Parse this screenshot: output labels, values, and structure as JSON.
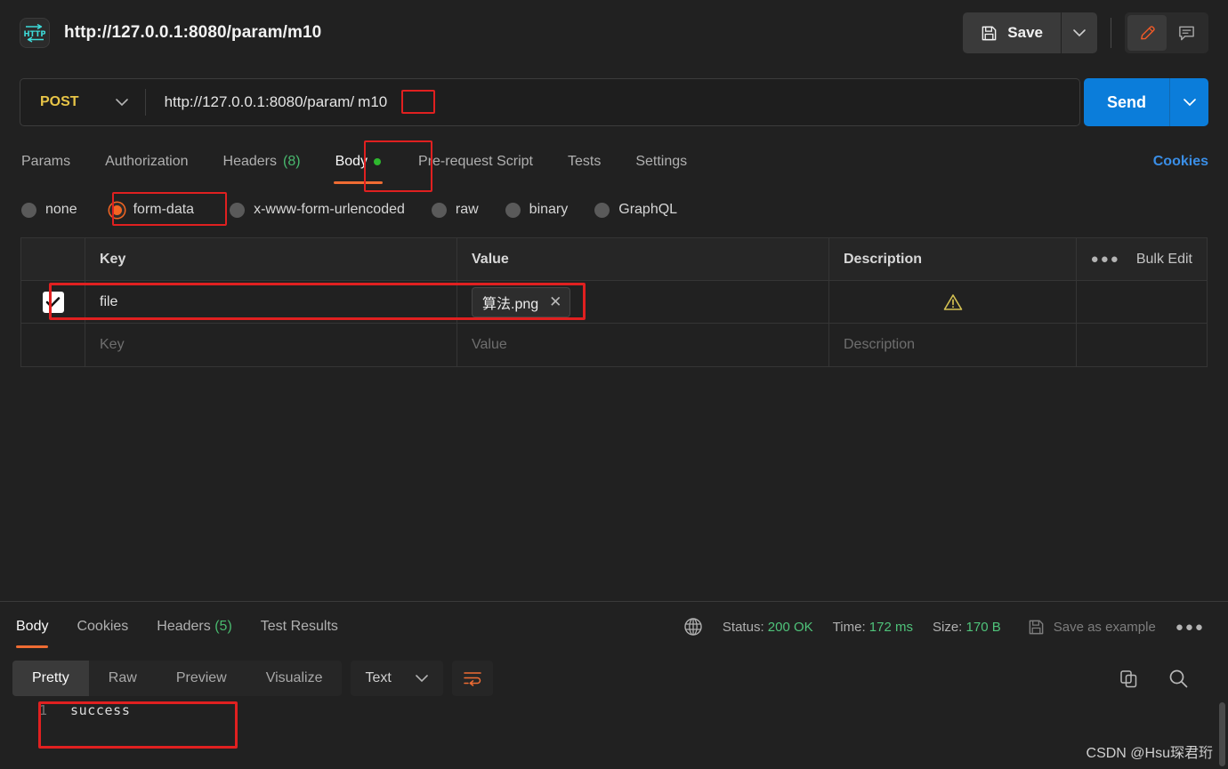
{
  "header": {
    "protocol_icon": "http-icon",
    "request_title": "http://127.0.0.1:8080/param/m10",
    "save_label": "Save",
    "save_icon": "floppy-disk-icon",
    "save_caret_icon": "chevron-down-icon",
    "edit_icon": "pencil-icon",
    "comment_icon": "comment-icon"
  },
  "urlbar": {
    "method": "POST",
    "method_caret_icon": "chevron-down-icon",
    "url_prefix": "http://127.0.0.1:8080/param/",
    "url_highlight": "m10",
    "send_label": "Send",
    "send_caret_icon": "chevron-down-icon"
  },
  "request_tabs": {
    "items": [
      {
        "label": "Params",
        "active": false
      },
      {
        "label": "Authorization",
        "active": false
      },
      {
        "label": "Headers",
        "count": "(8)",
        "active": false
      },
      {
        "label": "Body",
        "active": true,
        "dot": true
      },
      {
        "label": "Pre-request Script",
        "active": false
      },
      {
        "label": "Tests",
        "active": false
      },
      {
        "label": "Settings",
        "active": false
      }
    ],
    "cookies_link": "Cookies"
  },
  "body_types": [
    {
      "label": "none",
      "selected": false
    },
    {
      "label": "form-data",
      "selected": true
    },
    {
      "label": "x-www-form-urlencoded",
      "selected": false
    },
    {
      "label": "raw",
      "selected": false
    },
    {
      "label": "binary",
      "selected": false
    },
    {
      "label": "GraphQL",
      "selected": false
    }
  ],
  "table": {
    "headers": {
      "key": "Key",
      "value": "Value",
      "description": "Description",
      "bulk_edit": "Bulk Edit",
      "more_icon": "ellipsis-icon"
    },
    "rows": [
      {
        "checked": true,
        "key": "file",
        "file_name": "算法.png",
        "remove_icon": "close-icon",
        "warning_icon": "warning-triangle-icon",
        "description": ""
      }
    ],
    "placeholder_row": {
      "key": "Key",
      "value": "Value",
      "description": "Description"
    }
  },
  "response": {
    "tabs": [
      {
        "label": "Body",
        "active": true
      },
      {
        "label": "Cookies",
        "active": false
      },
      {
        "label": "Headers",
        "count": "(5)",
        "active": false
      },
      {
        "label": "Test Results",
        "active": false
      }
    ],
    "globe_icon": "globe-icon",
    "status_label": "Status:",
    "status_value": "200 OK",
    "time_label": "Time:",
    "time_value": "172 ms",
    "size_label": "Size:",
    "size_value": "170 B",
    "save_example_label": "Save as example",
    "save_example_icon": "floppy-disk-icon",
    "more_icon": "ellipsis-icon",
    "view_modes": [
      {
        "label": "Pretty",
        "active": true
      },
      {
        "label": "Raw",
        "active": false
      },
      {
        "label": "Preview",
        "active": false
      },
      {
        "label": "Visualize",
        "active": false
      }
    ],
    "format": "Text",
    "format_caret_icon": "chevron-down-icon",
    "wrap_icon": "word-wrap-icon",
    "copy_icon": "copy-icon",
    "search_icon": "search-icon",
    "body_line_number": "1",
    "body_text": "success"
  },
  "watermark": "CSDN @Hsu琛君珩",
  "colors": {
    "accent_orange": "#ef6c33",
    "send_blue": "#0b7dda",
    "method_yellow": "#e8c547",
    "success_green": "#4fc37a",
    "annotation_red": "#e02020",
    "warning_yellow": "#d4c152",
    "background": "#212121"
  }
}
